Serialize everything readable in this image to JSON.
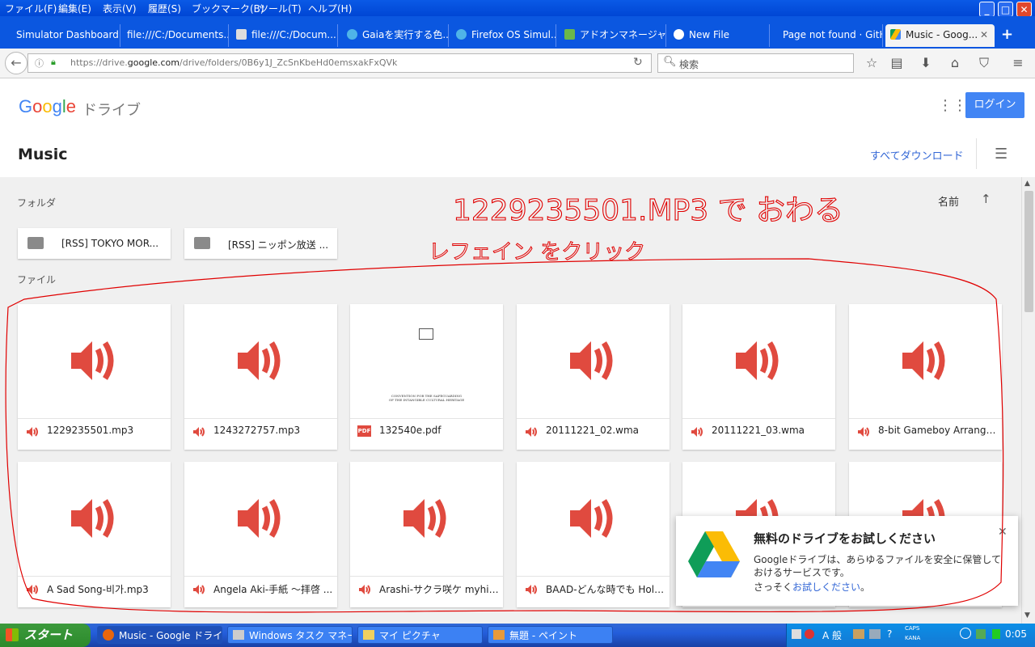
{
  "menubar": {
    "items": [
      "ファイル(F)",
      "編集(E)",
      "表示(V)",
      "履歴(S)",
      "ブックマーク(B)",
      "ツール(T)",
      "ヘルプ(H)"
    ]
  },
  "window_controls": {
    "minimize": "_",
    "maximize": "□",
    "close": "✕"
  },
  "tabs": [
    {
      "label": "Simulator Dashboard ...",
      "icon": "none"
    },
    {
      "label": "file:///C:/Documents...",
      "icon": "none"
    },
    {
      "label": "file:///C:/Docum...",
      "icon": "page-icon"
    },
    {
      "label": "Gaiaを実行する色...",
      "icon": "firefox-os-icon"
    },
    {
      "label": "Firefox OS Simul...",
      "icon": "firefox-os-icon"
    },
    {
      "label": "アドオンマネージャー",
      "icon": "puzzle-icon"
    },
    {
      "label": "New File",
      "icon": "github-icon"
    },
    {
      "label": "Page not found · GitH...",
      "icon": "none"
    },
    {
      "label": "Music - Goog...",
      "icon": "drive-icon",
      "active": true
    }
  ],
  "new_tab_label": "+",
  "urlbar": {
    "prefix": "https://drive.",
    "domain": "google.com",
    "suffix": "/drive/folders/0B6y1J_ZcSnKbeHd0emsxakFxQVk"
  },
  "searchbar": {
    "placeholder": "検索"
  },
  "drive": {
    "logo_letters": [
      "G",
      "o",
      "o",
      "g",
      "l",
      "e"
    ],
    "logo_colors": [
      "#4285f4",
      "#ea4335",
      "#fbbc05",
      "#4285f4",
      "#34a853",
      "#ea4335"
    ],
    "product": "ドライブ",
    "login_button": "ログイン",
    "folder_title": "Music",
    "download_all": "すべてダウンロード",
    "folders_section": "フォルダ",
    "files_section": "ファイル",
    "sort_label": "名前",
    "sort_arrow": "↑",
    "folders": [
      "[RSS] TOKYO MOR...",
      "[RSS] ニッポン放送 ..."
    ],
    "files_row1": [
      {
        "name": "1229235501.mp3",
        "type": "audio"
      },
      {
        "name": "1243272757.mp3",
        "type": "audio"
      },
      {
        "name": "132540e.pdf",
        "type": "pdf"
      },
      {
        "name": "20111221_02.wma",
        "type": "audio"
      },
      {
        "name": "20111221_03.wma",
        "type": "audio"
      },
      {
        "name": "8-bit Gameboy Arrange-...",
        "type": "audio"
      }
    ],
    "files_row2": [
      {
        "name": "A Sad Song-비가.mp3",
        "type": "audio"
      },
      {
        "name": "Angela Aki-手紙 ～拝啓 ...",
        "type": "audio"
      },
      {
        "name": "Arashi-サクラ咲ケ myhit...",
        "type": "audio"
      },
      {
        "name": "BAAD-どんな時でも Hold...",
        "type": "audio"
      },
      {
        "name": "",
        "type": "audio"
      },
      {
        "name": "",
        "type": "audio"
      }
    ],
    "pdf_text_line1": "CONVENTION FOR THE SAFEGUARDING",
    "pdf_text_line2": "OF THE INTANGIBLE CULTURAL HERITAGE",
    "pdf_badge": "PDF"
  },
  "promo": {
    "title": "無料のドライブをお試しください",
    "body": "Googleドライブは、あらゆるファイルを安全に保管しておけるサービスです。",
    "cta_prefix": "さっそく",
    "cta_link": "お試しください",
    "cta_suffix": "。",
    "close": "✕"
  },
  "annotation": {
    "color": "#e00000",
    "text_line1": "1229235501.MP3 で おわる",
    "text_line2": "レフェイン をクリック"
  },
  "taskbar": {
    "start": "スタート",
    "buttons": [
      {
        "label": "Music - Google ドライ...",
        "active": true
      },
      {
        "label": "Windows タスク マネー...",
        "active": false
      },
      {
        "label": "マイ ピクチャ",
        "active": false
      },
      {
        "label": "無題 - ペイント",
        "active": false
      }
    ],
    "ime": "A 般",
    "caps": "CAPS",
    "kana": "KANA",
    "clock": "0:05"
  },
  "colors": {
    "accent_blue": "#4285f4",
    "audio_red": "#e04a3f",
    "link_blue": "#3367d6"
  }
}
